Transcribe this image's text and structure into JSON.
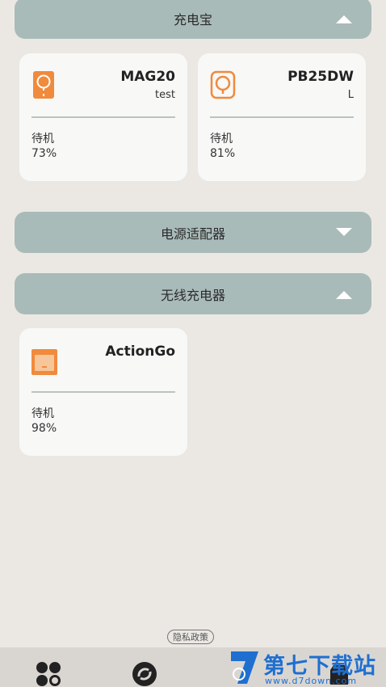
{
  "sections": {
    "power_bank": {
      "title": "充电宝",
      "expanded": true
    },
    "adapter": {
      "title": "电源适配器",
      "expanded": false
    },
    "wireless": {
      "title": "无线充电器",
      "expanded": true
    }
  },
  "devices": {
    "mag20": {
      "name": "MAG20",
      "sub": "test",
      "status": "待机",
      "battery": "73%",
      "icon": "magnetic-power-bank-icon"
    },
    "pb25dw": {
      "name": "PB25DW",
      "sub": "L",
      "status": "待机",
      "battery": "81%",
      "icon": "ring-power-bank-icon"
    },
    "actiongo": {
      "name": "ActionGo",
      "status": "待机",
      "battery": "98%",
      "icon": "wireless-charger-icon"
    }
  },
  "footer": {
    "privacy": "隐私政策"
  },
  "tabs": [
    "devices-tab-icon",
    "refresh-tab-icon",
    "store-tab-icon"
  ],
  "watermark": {
    "title": "第七下载站",
    "url": "www.d7down.com"
  },
  "colors": {
    "accent": "#f08a3c",
    "header": "#a9bbb8",
    "background": "#ebe8e4",
    "card": "#f8f8f7"
  }
}
